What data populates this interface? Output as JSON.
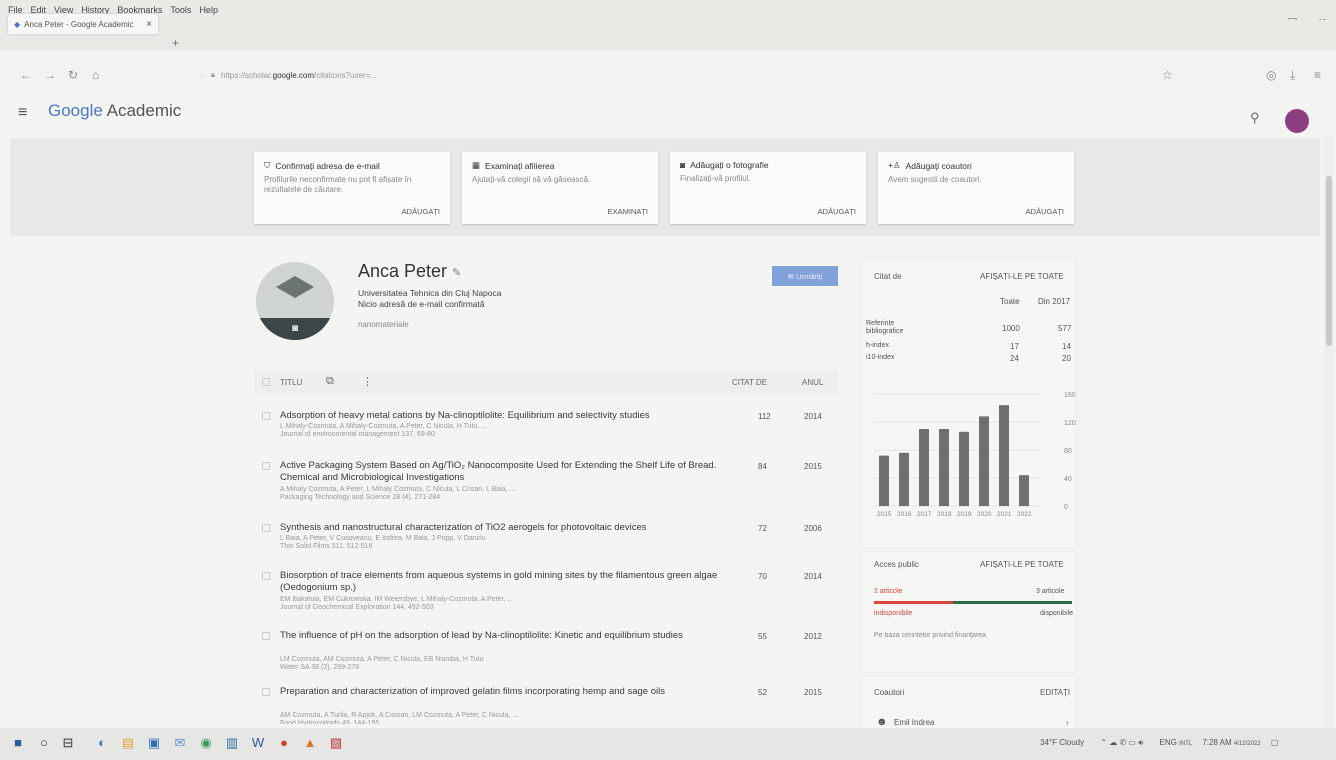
{
  "browser": {
    "menu": [
      "File",
      "Edit",
      "View",
      "History",
      "Bookmarks",
      "Tools",
      "Help"
    ],
    "tab_title": "Anca Peter - Google Academic",
    "url_prefix": "https://scholar.",
    "url_domain": "google.com",
    "url_rest": "/citations?user=..."
  },
  "app": {
    "logo_prefix": "Google",
    "logo_suffix": " Academic"
  },
  "banner_cards": [
    {
      "title": "Confirmați adresa de e-mail",
      "desc": "Profilurile neconfirmate nu pot fi afișate în rezultatele de căutare.",
      "action": "ADĂUGAȚI",
      "icon": "shield-icon"
    },
    {
      "title": "Examinați afilierea",
      "desc": "Ajutați-vă colegii să vă găsească.",
      "action": "EXAMINAȚI",
      "icon": "building-icon"
    },
    {
      "title": "Adăugați o fotografie",
      "desc": "Finalizați-vă profilul.",
      "action": "ADĂUGAȚI",
      "icon": "camera-icon"
    },
    {
      "title": "Adăugați coautori",
      "desc": "Avem sugestii de coautori.",
      "action": "ADĂUGAȚI",
      "icon": "add-person-icon"
    }
  ],
  "profile": {
    "name": "Anca Peter",
    "affiliation": "Universitatea Tehnica din Cluj Napoca",
    "email_status": "Nicio adresă de e-mail confirmată",
    "keywords": "nanomateriale",
    "follow_label": "Urmăriți"
  },
  "table": {
    "col_title": "TITLU",
    "col_cited": "CITAT DE",
    "col_year": "ANUL",
    "rows": [
      {
        "title": "Adsorption of heavy metal cations by Na-clinoptilolite: Equilibrium and selectivity studies",
        "authors": "L Mihaly-Cozmuta, A Mihaly-Cozmuta, A Peter, C Nicula, H Tutu, ...",
        "journal": "Journal of environmental management 137, 69-80",
        "cited": "112",
        "year": "2014"
      },
      {
        "title": "Active Packaging System Based on Ag/TiO₂ Nanocomposite Used for Extending the Shelf Life of Bread. Chemical and Microbiological Investigations",
        "authors": "A Mihaly Cozmuta, A Peter, L Mihaly Cozmuta, C Nicula, L Crisan, L Baia, ...",
        "journal": "Packaging Technology and Science 28 (4), 271-284",
        "cited": "84",
        "year": "2015"
      },
      {
        "title": "Synthesis and nanostructural characterization of TiO2 aerogels for photovoltaic devices",
        "authors": "L Baia, A Peter, V Cosoveanu, E Indrea, M Baia, J Popp, V Danciu",
        "journal": "Thin Solid Films 511, 512-516",
        "cited": "72",
        "year": "2006"
      },
      {
        "title": "Biosorption of trace elements from aqueous systems in gold mining sites by the filamentous green algae (Oedogonium sp.)",
        "authors": "EM Bakatula, EM Cukrowska, IM Weiersbye, L Mihaly-Cozmuta, A Peter, ...",
        "journal": "Journal of Geochemical Exploration 144, 492-503",
        "cited": "70",
        "year": "2014"
      },
      {
        "title": "The influence of pH on the adsorption of lead by Na-clinoptilolite: Kinetic and equilibrium studies",
        "authors": "LM Cozmuta, AM Cozmuta, A Peter, C Nicula, EB Nsimba, H Tutu",
        "journal": "Water SA 38 (2), 269-278",
        "cited": "55",
        "year": "2012"
      },
      {
        "title": "Preparation and characterization of improved gelatin films incorporating hemp and sage oils",
        "authors": "AM Cozmuta, A Turila, R Apjok, A Ciocian, LM Cozmuta, A Peter, C Nicula, ...",
        "journal": "Food Hydrocolloids 49, 144-155",
        "cited": "52",
        "year": "2015"
      }
    ]
  },
  "cited_by": {
    "title": "Citat de",
    "view_all": "AFIȘAȚI-LE PE TOATE",
    "col_all": "Toate",
    "col_since": "Din 2017",
    "metrics": [
      {
        "label": "Referințe bibliografice",
        "all": "1000",
        "since": "577"
      },
      {
        "label": "h-index",
        "all": "17",
        "since": "14"
      },
      {
        "label": "i10-index",
        "all": "24",
        "since": "20"
      }
    ]
  },
  "chart_data": {
    "type": "bar",
    "categories": [
      "2015",
      "2016",
      "2017",
      "2018",
      "2019",
      "2020",
      "2021",
      "2022"
    ],
    "values": [
      72,
      76,
      110,
      110,
      106,
      128,
      144,
      44
    ],
    "yticks": [
      "160",
      "120",
      "80",
      "40",
      "0"
    ],
    "ylim": [
      0,
      160
    ]
  },
  "public_access": {
    "title": "Acces public",
    "view_all": "AFIȘAȚI-LE PE TOATE",
    "left_count": "2 articole",
    "right_count": "3 articole",
    "left_label": "indisponibile",
    "right_label": "disponibile",
    "note": "Pe baza cerințelor privind finanțarea",
    "unavailable_share": 0.4,
    "unavailable_color": "#d9473e",
    "available_color": "#2f6b45"
  },
  "coauthors": {
    "title": "Coautori",
    "edit": "EDITAȚI",
    "first": "Emil Indrea"
  },
  "taskbar": {
    "weather": "34°F Cloudy",
    "lang": "ENG",
    "region": "INTL",
    "time": "7:28 AM",
    "date": "4/12/2022"
  }
}
